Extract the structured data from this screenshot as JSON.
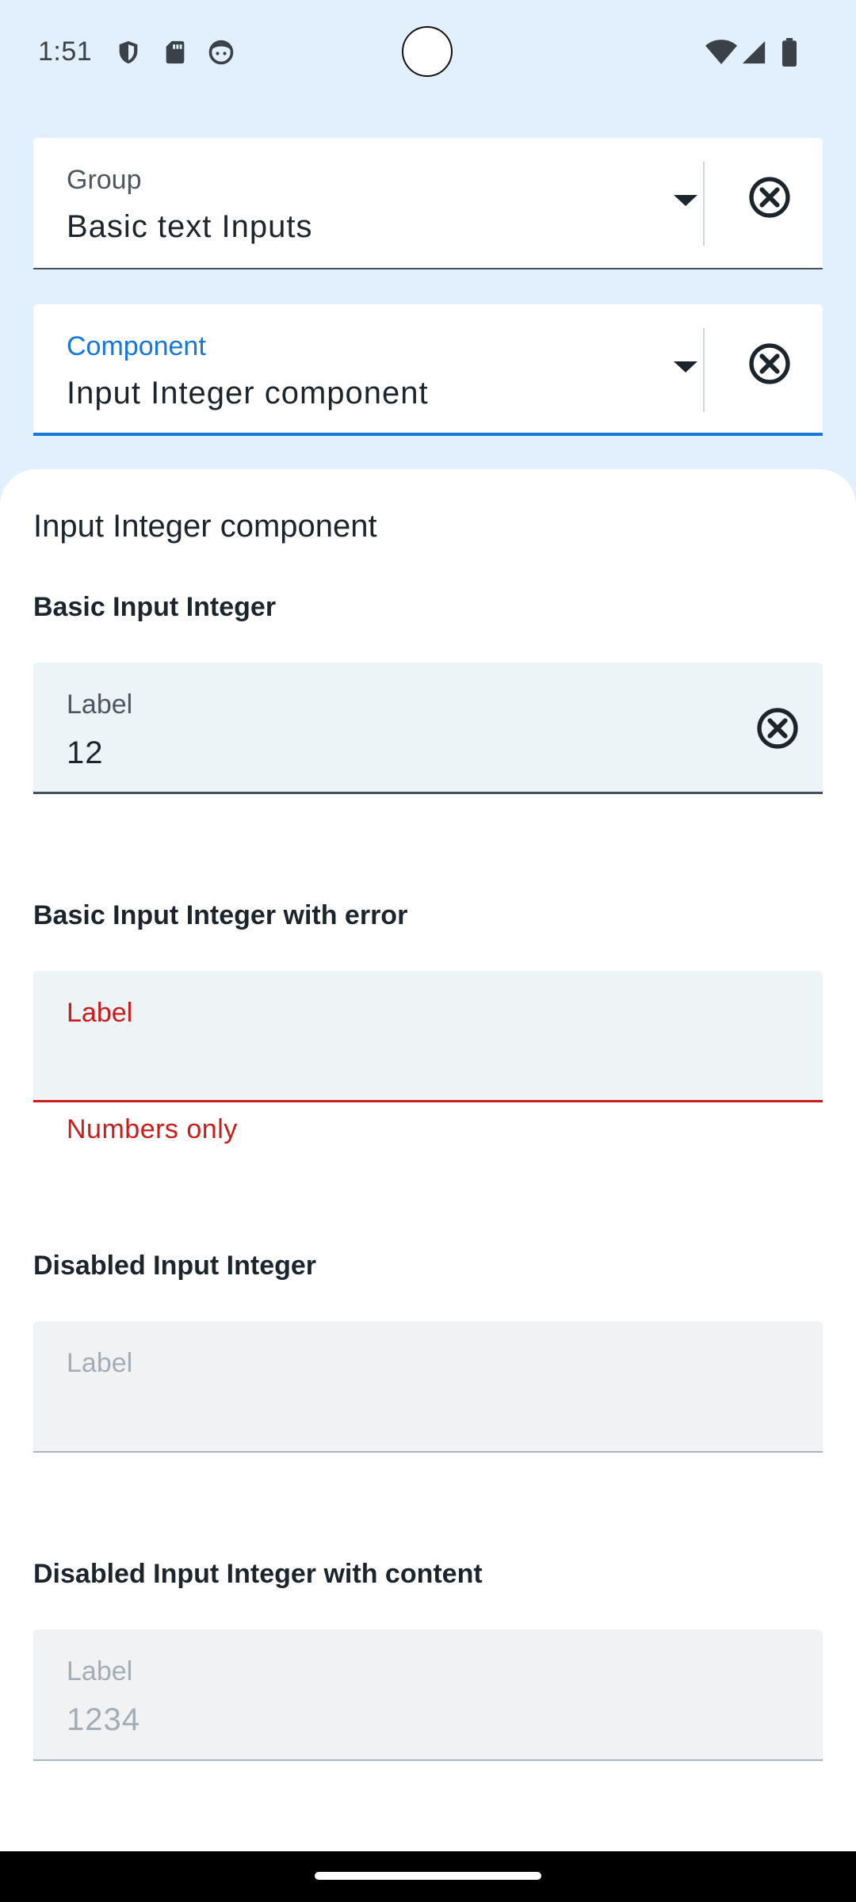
{
  "status_bar": {
    "time": "1:51",
    "left_icons": [
      "shield-icon",
      "sd-card-icon",
      "face-icon"
    ],
    "right_icons": [
      "wifi-icon",
      "signal-icon",
      "battery-icon"
    ]
  },
  "selectors": {
    "group": {
      "label": "Group",
      "value": "Basic text Inputs"
    },
    "component": {
      "label": "Component",
      "value": "Input Integer component"
    }
  },
  "content": {
    "title": "Input Integer component",
    "sections": [
      {
        "title": "Basic Input Integer",
        "field_label": "Label",
        "field_value": "12"
      },
      {
        "title": "Basic Input Integer with error",
        "field_label": "Label",
        "field_value": "",
        "error": "Numbers only"
      },
      {
        "title": "Disabled Input Integer",
        "field_label": "Label",
        "field_value": ""
      },
      {
        "title": "Disabled Input Integer with content",
        "field_label": "Label",
        "field_value": "1234"
      }
    ]
  },
  "colors": {
    "accent": "#1777d6",
    "error": "#cc1b1b",
    "header_bg": "#e2f0fd",
    "disabled_text": "#a4acb4"
  }
}
